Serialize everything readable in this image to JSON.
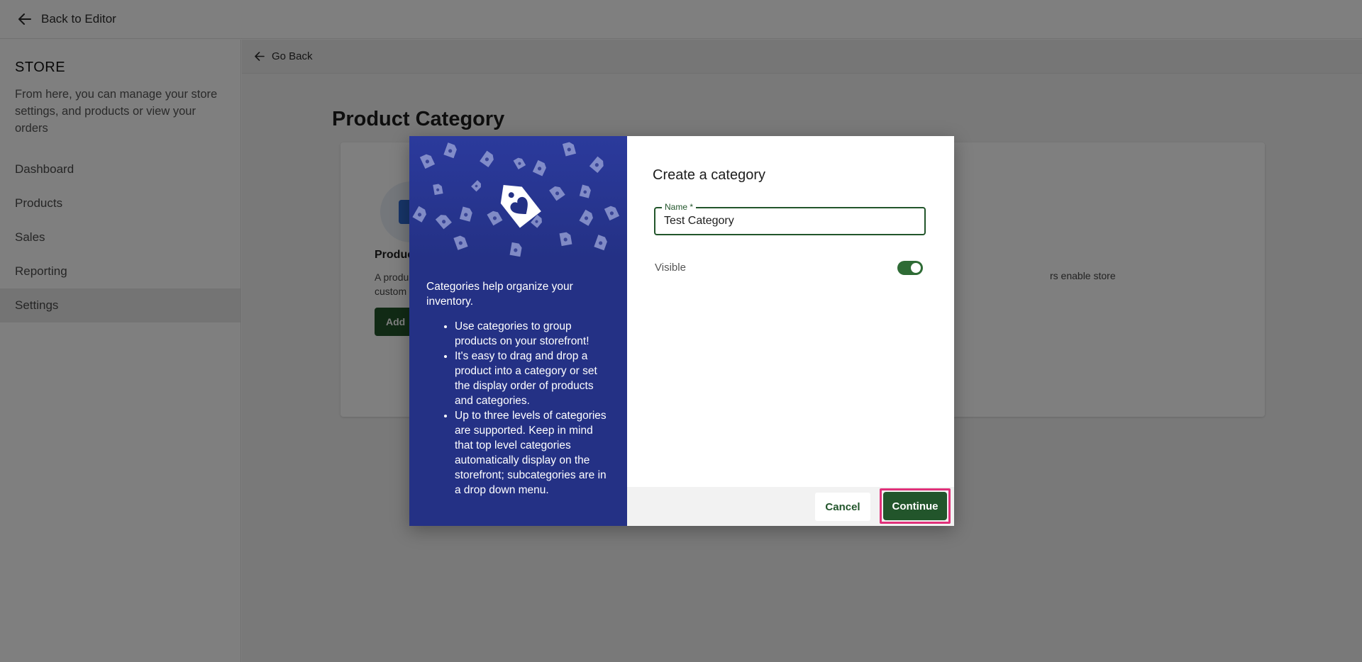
{
  "topbar": {
    "back_label": "Back to Editor"
  },
  "sidebar": {
    "title": "STORE",
    "description": "From here, you can manage your store settings, and products or view your orders",
    "items": [
      {
        "label": "Dashboard"
      },
      {
        "label": "Products"
      },
      {
        "label": "Sales"
      },
      {
        "label": "Reporting"
      },
      {
        "label": "Settings"
      }
    ],
    "active_item": "Settings"
  },
  "main": {
    "go_back_label": "Go Back",
    "page_title": "Product Category",
    "card": {
      "heading_visible": "Produc",
      "text_visible_line1": "A produ",
      "text_visible_line2": "custom",
      "text_visible_right": "rs enable store",
      "add_button_visible": "Add"
    }
  },
  "modal": {
    "title": "Create a category",
    "name_field": {
      "label": "Name *",
      "value": "Test Category"
    },
    "visible_label": "Visible",
    "visible_on": true,
    "info_intro": "Categories help organize your inventory.",
    "info_points": [
      "Use categories to group products on your storefront!",
      "It's easy to drag and drop a product into a category or set the display order of products and categories.",
      "Up to three levels of categories are supported. Keep in mind that top level categories automatically display on the storefront; subcategories are in a drop down menu."
    ],
    "cancel_label": "Cancel",
    "continue_label": "Continue",
    "icons": {
      "hero": "tag-heart-icon"
    }
  },
  "colors": {
    "primary_green": "#22552b",
    "info_panel_blue": "#243185",
    "highlight_pink": "#e0317a"
  }
}
